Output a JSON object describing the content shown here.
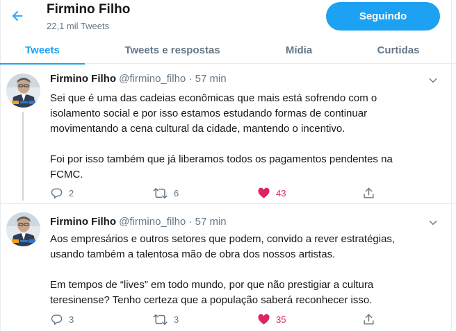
{
  "header": {
    "title": "Firmino Filho",
    "subtitle": "22,1 mil Tweets",
    "follow_label": "Seguindo",
    "back_icon": "arrow-left-icon",
    "accent": "#1da1f2"
  },
  "tabs": [
    {
      "label": "Tweets",
      "active": true
    },
    {
      "label": "Tweets e respostas",
      "active": false
    },
    {
      "label": "Mídia",
      "active": false
    },
    {
      "label": "Curtidas",
      "active": false
    }
  ],
  "tweets": [
    {
      "name": "Firmino Filho",
      "handle": "@firmino_filho",
      "separator": "·",
      "time": "57 min",
      "paragraphs": [
        [
          "Sei que é uma das cadeias econômicas que mais está sofrendo com o",
          "isolamento social e por isso estamos estudando formas de continuar",
          "movimentando a cena cultural da cidade, mantendo o incentivo."
        ],
        [
          "Foi por isso também que já liberamos todos os pagamentos pendentes na",
          "FCMC."
        ]
      ],
      "replies": "2",
      "retweets": "6",
      "likes": "43",
      "liked": true
    },
    {
      "name": "Firmino Filho",
      "handle": "@firmino_filho",
      "separator": "·",
      "time": "57 min",
      "paragraphs": [
        [
          "Aos empresários e outros setores que podem, convido a rever estratégias,",
          "usando também a talentosa mão de obra dos nossos artistas."
        ],
        [
          "Em tempos de “lives” em todo mundo, por que não prestigiar a cultura",
          "teresinense? Tenho certeza que a população saberá reconhecer isso."
        ]
      ],
      "replies": "3",
      "retweets": "3",
      "likes": "35",
      "liked": true
    }
  ],
  "colors": {
    "text": "#14171a",
    "secondary": "#657786",
    "like": "#e0245e",
    "border": "#e6ecf0"
  }
}
